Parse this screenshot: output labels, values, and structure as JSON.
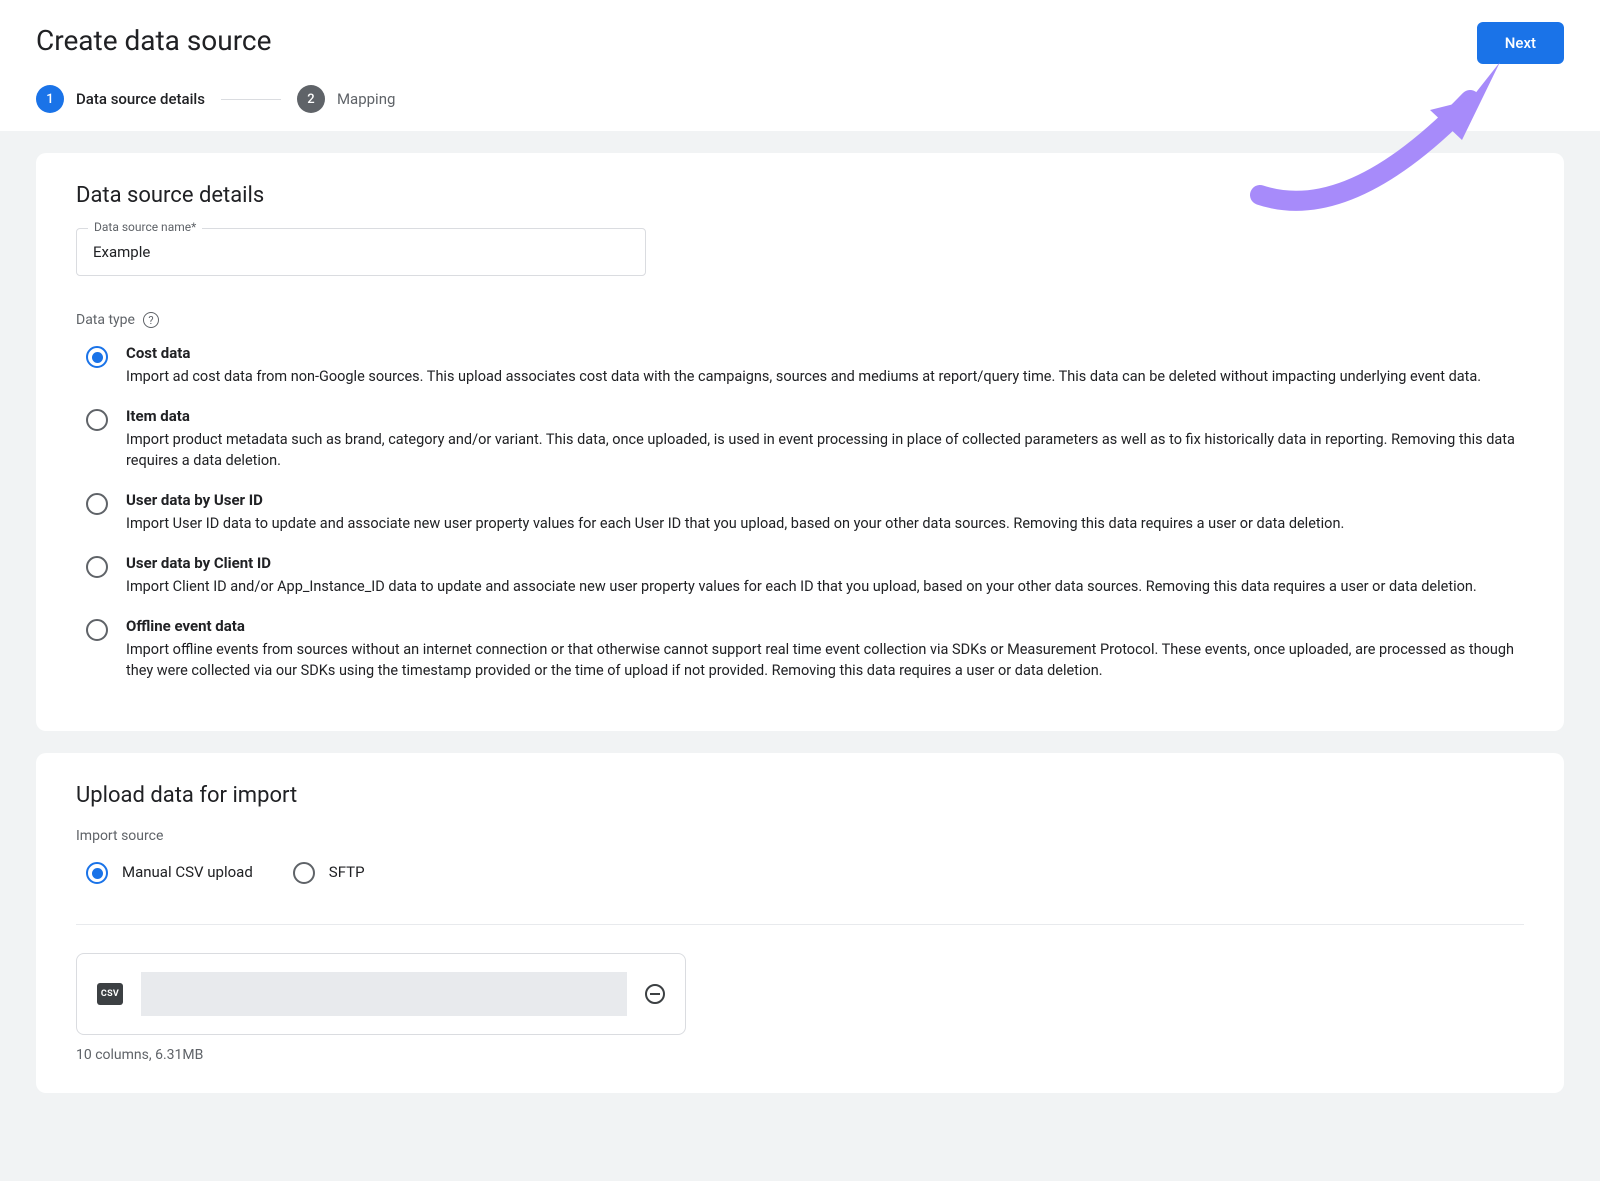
{
  "header": {
    "title": "Create data source",
    "next_label": "Next"
  },
  "stepper": {
    "step1_num": "1",
    "step1_label": "Data source details",
    "step2_num": "2",
    "step2_label": "Mapping"
  },
  "details": {
    "card_title": "Data source details",
    "name_label": "Data source name*",
    "name_value": "Example",
    "datatype_label": "Data type",
    "options": [
      {
        "title": "Cost data",
        "desc": "Import ad cost data from non-Google sources. This upload associates cost data with the campaigns, sources and mediums at report/query time. This data can be deleted without impacting underlying event data.",
        "selected": true
      },
      {
        "title": "Item data",
        "desc": "Import product metadata such as brand, category and/or variant. This data, once uploaded, is used in event processing in place of collected parameters as well as to fix historically data in reporting. Removing this data requires a data deletion.",
        "selected": false
      },
      {
        "title": "User data by User ID",
        "desc": "Import User ID data to update and associate new user property values for each User ID that you upload, based on your other data sources. Removing this data requires a user or data deletion.",
        "selected": false
      },
      {
        "title": "User data by Client ID",
        "desc": "Import Client ID and/or App_Instance_ID data to update and associate new user property values for each ID that you upload, based on your other data sources. Removing this data requires a user or data deletion.",
        "selected": false
      },
      {
        "title": "Offline event data",
        "desc": "Import offline events from sources without an internet connection or that otherwise cannot support real time event collection via SDKs or Measurement Protocol. These events, once uploaded, are processed as though they were collected via our SDKs using the timestamp provided or the time of upload if not provided. Removing this data requires a user or data deletion.",
        "selected": false
      }
    ]
  },
  "upload": {
    "card_title": "Upload data for import",
    "source_label": "Import source",
    "options": [
      {
        "label": "Manual CSV upload",
        "selected": true
      },
      {
        "label": "SFTP",
        "selected": false
      }
    ],
    "csv_badge": "CSV",
    "file_meta": "10 columns, 6.31MB"
  }
}
